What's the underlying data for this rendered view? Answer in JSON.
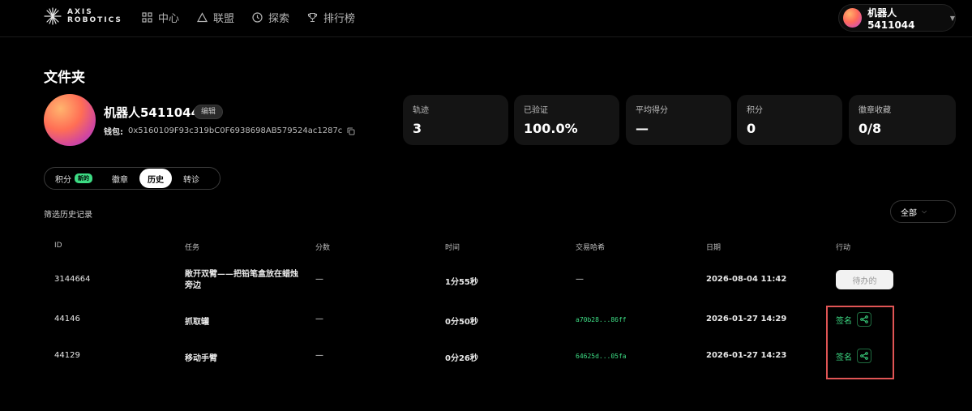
{
  "brand": {
    "line1": "AXIS",
    "line2": "ROBOTICS"
  },
  "nav": [
    {
      "label": "中心",
      "icon": "grid-icon"
    },
    {
      "label": "联盟",
      "icon": "triangle-icon"
    },
    {
      "label": "探索",
      "icon": "clock-icon"
    },
    {
      "label": "排行榜",
      "icon": "trophy-icon"
    }
  ],
  "user": {
    "name": "机器人5411044"
  },
  "page": {
    "title": "文件夹"
  },
  "profile": {
    "name": "机器人5411044",
    "edit_label": "编辑",
    "wallet_label": "钱包:",
    "wallet_address": "0x5160109F93c319bC0F6938698AB579524ac1287c"
  },
  "stats": [
    {
      "label": "轨迹",
      "value": "3"
    },
    {
      "label": "已验证",
      "value": "100.0%"
    },
    {
      "label": "平均得分",
      "value": "—"
    },
    {
      "label": "积分",
      "value": "0"
    },
    {
      "label": "徽章收藏",
      "value": "0/8"
    }
  ],
  "tabs": [
    {
      "label": "积分",
      "badge": "新的"
    },
    {
      "label": "徽章"
    },
    {
      "label": "历史",
      "active": true
    },
    {
      "label": "转诊"
    }
  ],
  "filter": {
    "label": "筛选历史记录",
    "selected": "全部"
  },
  "table": {
    "columns": [
      "ID",
      "任务",
      "分数",
      "时间",
      "交易哈希",
      "日期",
      "行动"
    ],
    "rows": [
      {
        "id": "3144664",
        "task": "敞开双臂——把铅笔盒放在蜡烛旁边",
        "score": "—",
        "time": "1分55秒",
        "hash": "—",
        "date": "2026-08-04 11:42",
        "action": "待办的"
      },
      {
        "id": "44146",
        "task": "抓取罐",
        "score": "—",
        "time": "0分50秒",
        "hash": "a70b28...86ff",
        "date": "2026-01-27 14:29",
        "action": "签名"
      },
      {
        "id": "44129",
        "task": "移动手臂",
        "score": "—",
        "time": "0分26秒",
        "hash": "64625d...05fa",
        "date": "2026-01-27 14:23",
        "action": "签名"
      }
    ]
  },
  "colors": {
    "accent_green": "#3ddc84",
    "highlight_red": "#e05555",
    "card_bg": "#141414"
  }
}
